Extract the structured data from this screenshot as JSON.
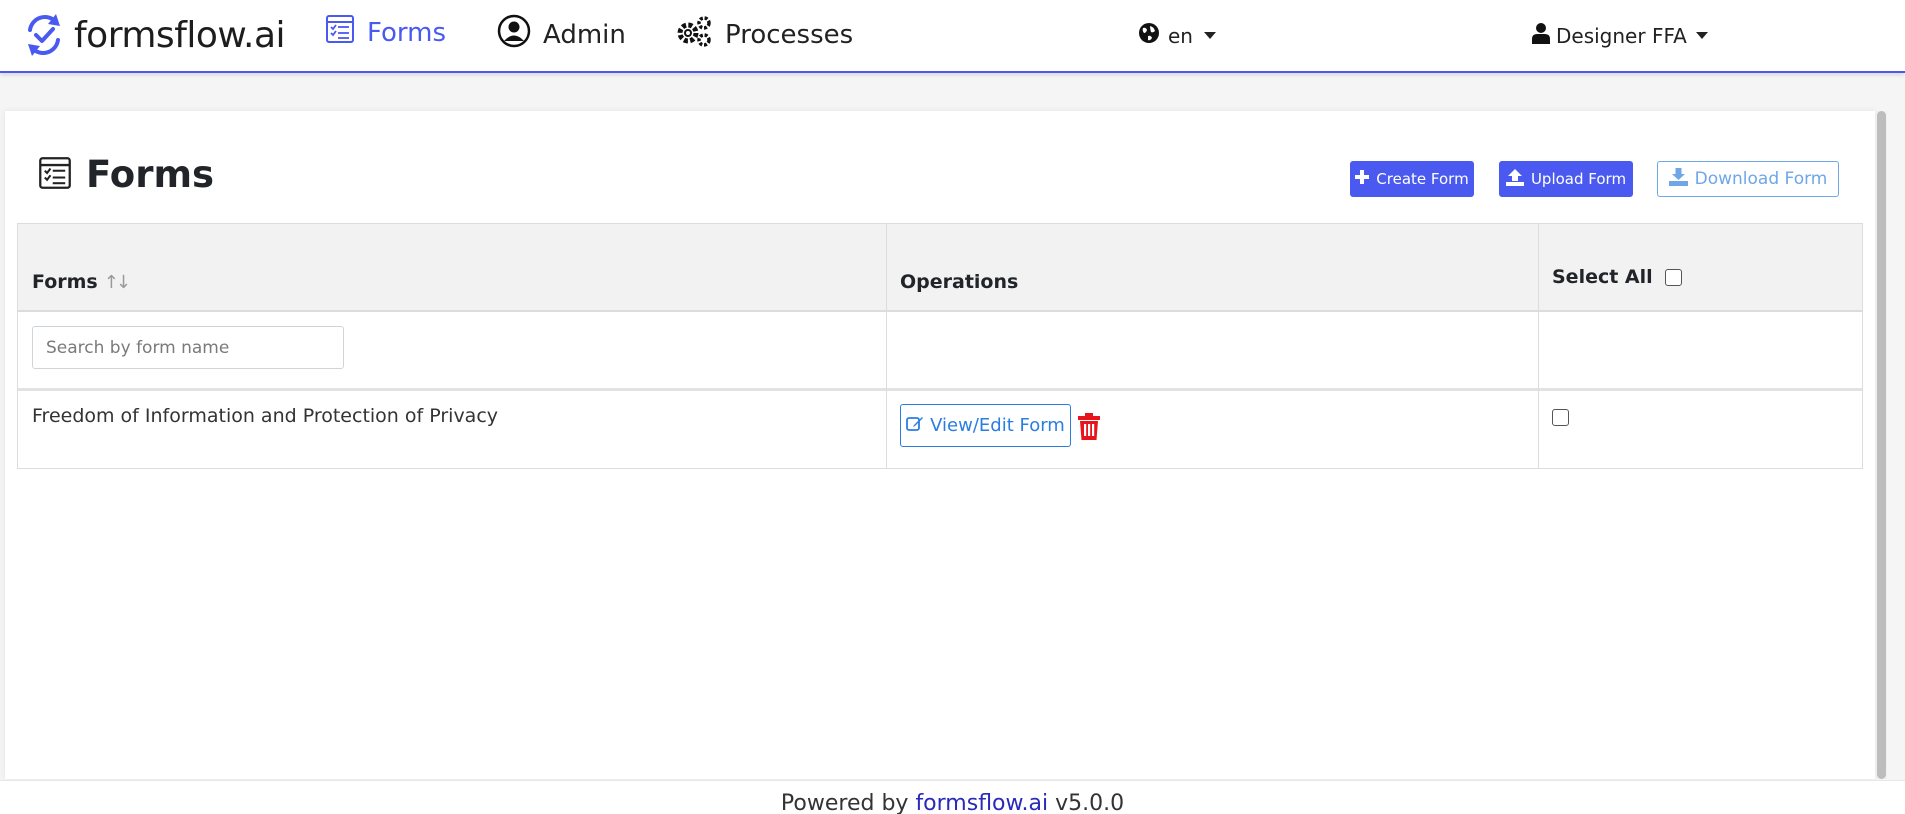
{
  "navbar": {
    "brand_name": "formsflow.ai",
    "items": [
      {
        "label": "Forms",
        "active": true
      },
      {
        "label": "Admin",
        "active": false
      },
      {
        "label": "Processes",
        "active": false
      }
    ],
    "language": "en",
    "user": "Designer FFA"
  },
  "page": {
    "title": "Forms",
    "buttons": {
      "create": "Create Form",
      "upload": "Upload Form",
      "download": "Download Form"
    }
  },
  "table": {
    "columns": [
      "Forms",
      "Operations",
      "Select All"
    ],
    "search_placeholder": "Search by form name",
    "rows": [
      {
        "name": "Freedom of Information and Protection of Privacy",
        "action": "View/Edit Form"
      }
    ]
  },
  "footer": {
    "prefix": "Powered by",
    "link": "formsflow.ai",
    "version": "v5.0.0"
  },
  "colors": {
    "accent": "#4a5af0",
    "link_blue": "#2a7de1",
    "danger": "#e8141c"
  }
}
